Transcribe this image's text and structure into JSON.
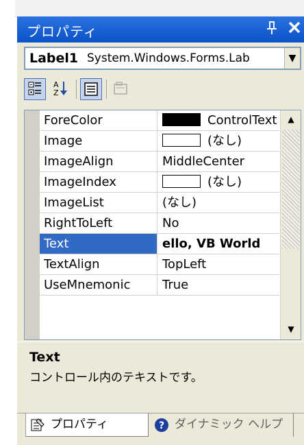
{
  "window": {
    "title": "プロパティ",
    "pin_glyph": "ᵖ",
    "close_glyph": "✕"
  },
  "selector": {
    "name": "Label1",
    "type": "System.Windows.Forms.Lab"
  },
  "toolbar": {
    "buttons": [
      "categorized-view",
      "alphabetical-sort",
      "properties",
      "property-pages"
    ]
  },
  "grid": {
    "rows": [
      {
        "name": "ForeColor",
        "value": "ControlText",
        "swatch": "black"
      },
      {
        "name": "Image",
        "value": "(なし)",
        "swatch": "white"
      },
      {
        "name": "ImageAlign",
        "value": "MiddleCenter"
      },
      {
        "name": "ImageIndex",
        "value": "(なし)",
        "swatch": "white"
      },
      {
        "name": "ImageList",
        "value": "(なし)"
      },
      {
        "name": "RightToLeft",
        "value": "No"
      },
      {
        "name": "Text",
        "value": "ello, VB World",
        "selected": true
      },
      {
        "name": "TextAlign",
        "value": "TopLeft"
      },
      {
        "name": "UseMnemonic",
        "value": "True"
      }
    ]
  },
  "description": {
    "title": "Text",
    "text": "コントロール内のテキストです。"
  },
  "tabs": [
    {
      "label": "プロパティ",
      "active": true
    },
    {
      "label": "ダイナミック ヘルプ",
      "active": false
    }
  ],
  "colors": {
    "titlebar": "#0a53c8",
    "selection": "#316ac5",
    "panel": "#ece9d8"
  }
}
